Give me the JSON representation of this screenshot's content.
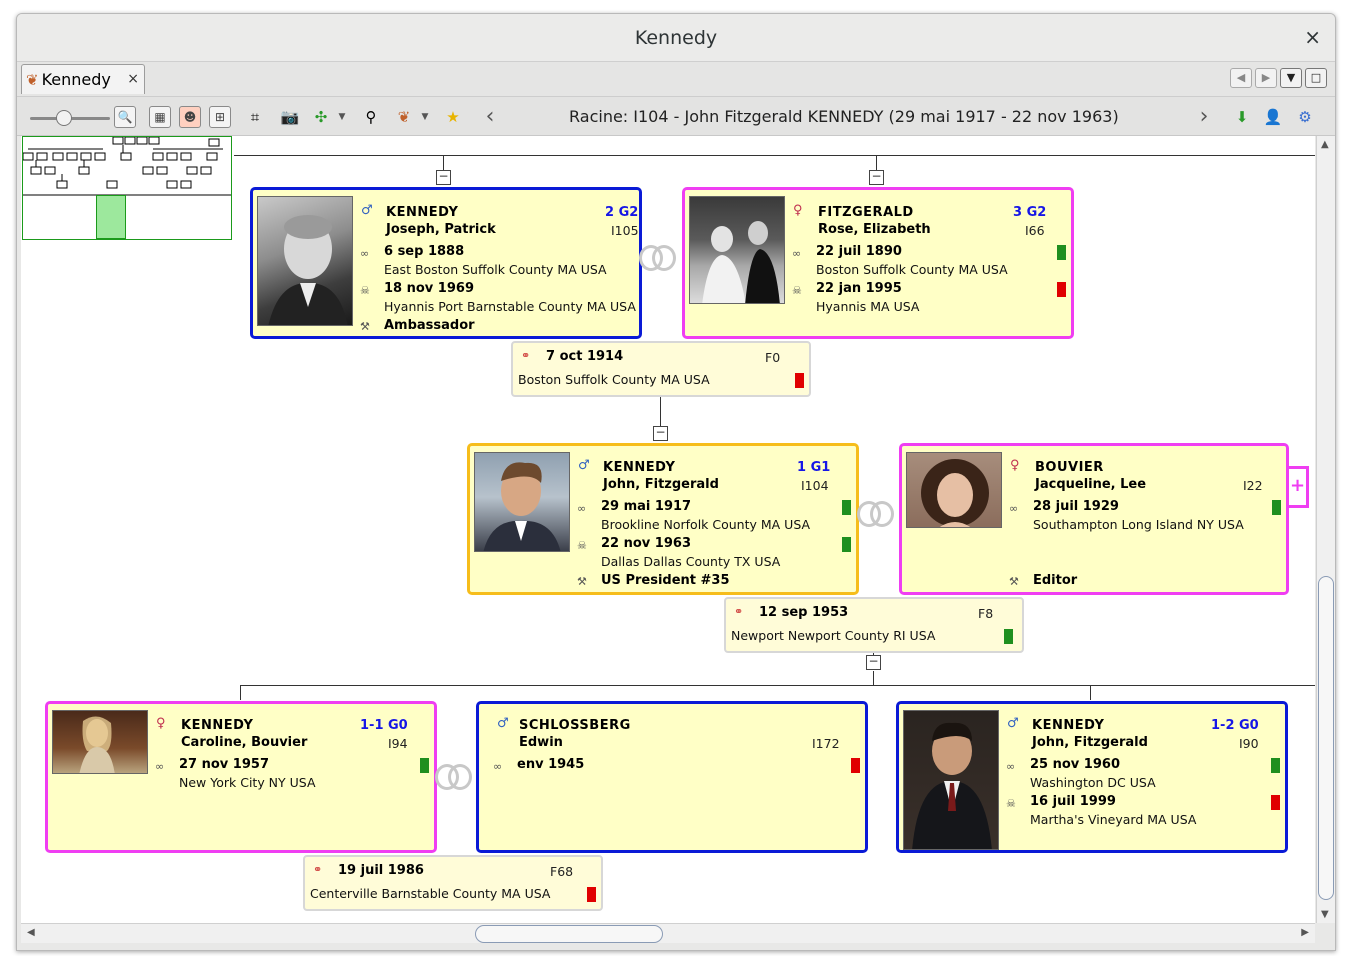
{
  "window": {
    "title": "Kennedy",
    "close": "×"
  },
  "tab": {
    "label": "Kennedy",
    "close": "×"
  },
  "toolbar": {
    "root_label": "Racine: I104 - John Fitzgerald KENNEDY (29 mai 1917 - 22 nov 1963)",
    "prev": "‹",
    "next": "›"
  },
  "people": {
    "father": {
      "surname": "KENNEDY",
      "given": "Joseph, Patrick",
      "gen": "2 G2",
      "id": "I105",
      "birth_date": "6 sep 1888",
      "birth_place": "East Boston Suffolk County MA USA",
      "death_date": "18 nov 1969",
      "death_place": "Hyannis Port Barnstable County MA USA",
      "occupation": "Ambassador"
    },
    "mother": {
      "surname": "FITZGERALD",
      "given": "Rose, Elizabeth",
      "gen": "3 G2",
      "id": "I66",
      "birth_date": "22 juil 1890",
      "birth_place": "Boston Suffolk County MA USA",
      "death_date": "22 jan 1995",
      "death_place": "Hyannis MA USA"
    },
    "root": {
      "surname": "KENNEDY",
      "given": "John, Fitzgerald",
      "gen": "1 G1",
      "id": "I104",
      "birth_date": "29 mai 1917",
      "birth_place": "Brookline Norfolk County MA USA",
      "death_date": "22 nov 1963",
      "death_place": "Dallas Dallas County TX USA",
      "occupation": "US President #35"
    },
    "spouse": {
      "surname": "BOUVIER",
      "given": "Jacqueline, Lee",
      "id": "I22",
      "birth_date": "28 juil 1929",
      "birth_place": "Southampton Long Island NY USA",
      "occupation": "Editor"
    },
    "child1": {
      "surname": "KENNEDY",
      "given": "Caroline, Bouvier",
      "gen": "1-1 G0",
      "id": "I94",
      "birth_date": "27 nov 1957",
      "birth_place": "New York City NY USA"
    },
    "child1_spouse": {
      "surname": "SCHLOSSBERG",
      "given": "Edwin",
      "id": "I172",
      "birth_date": "env 1945"
    },
    "child2": {
      "surname": "KENNEDY",
      "given": "John, Fitzgerald",
      "gen": "1-2 G0",
      "id": "I90",
      "birth_date": "25 nov 1960",
      "birth_place": "Washington DC USA",
      "death_date": "16 juil 1999",
      "death_place": "Martha's Vineyard MA USA"
    }
  },
  "families": {
    "f0": {
      "date": "7 oct 1914",
      "id": "F0",
      "place": "Boston Suffolk County MA USA"
    },
    "f8": {
      "date": "12 sep 1953",
      "id": "F8",
      "place": "Newport Newport County RI USA"
    },
    "f68": {
      "date": "19 juil 1986",
      "id": "F68",
      "place": "Centerville Barnstable County MA USA"
    }
  },
  "colors": {
    "male_border": "#0a1ad6",
    "female_border": "#ef3ef2",
    "root_border": "#f6bd1b",
    "card_bg": "#ffffc6",
    "flag_green": "#1f8f1f",
    "flag_red": "#e00000",
    "gen_text": "#1616e6"
  }
}
